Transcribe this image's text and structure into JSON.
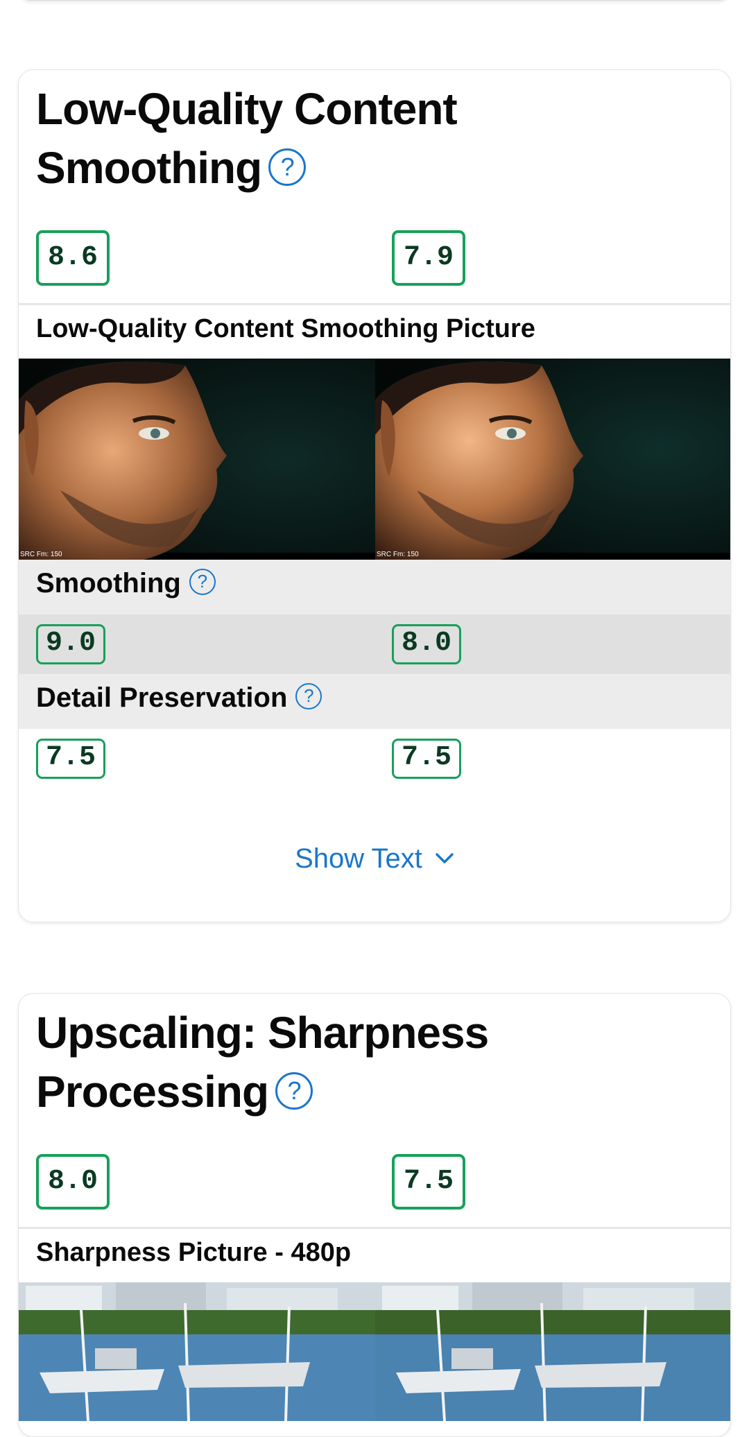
{
  "card1": {
    "title_line1": "Low-Quality Content",
    "title_line2": "Smoothing",
    "help_glyph": "?",
    "score_left": "8.6",
    "score_right": "7.9",
    "picture_title": "Low-Quality Content Smoothing Picture",
    "src_label_left": "SRC Fm: 150",
    "src_label_right": "SRC Fm: 150",
    "sub1_label": "Smoothing",
    "sub1_left": "9.0",
    "sub1_right": "8.0",
    "sub2_label": "Detail Preservation",
    "sub2_left": "7.5",
    "sub2_right": "7.5",
    "show_text": "Show Text"
  },
  "card2": {
    "title_line1": "Upscaling: Sharpness",
    "title_line2": "Processing",
    "help_glyph": "?",
    "score_left": "8.0",
    "score_right": "7.5",
    "picture_title": "Sharpness Picture - 480p"
  },
  "colors": {
    "accent_blue": "#1976c9",
    "score_green": "#17a05a",
    "score_text": "#0b3a22",
    "row_grey": "#ececec",
    "row_grey_dark": "#e0e0e0"
  },
  "icons": [
    "help-circle-icon",
    "chevron-down-icon"
  ]
}
